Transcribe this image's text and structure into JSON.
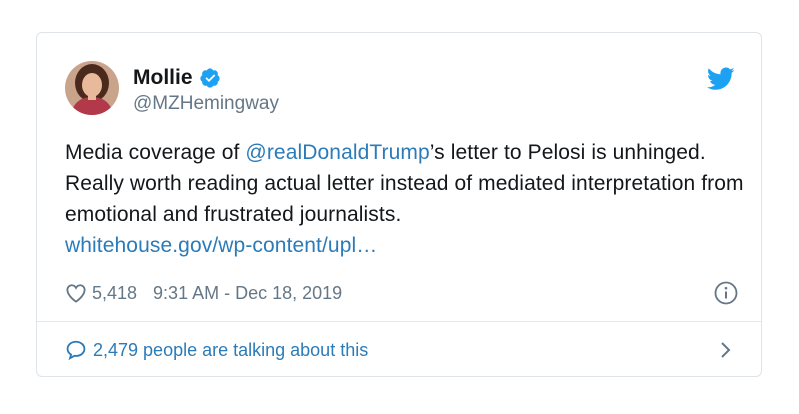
{
  "tweet": {
    "display_name": "Mollie",
    "handle": "@MZHemingway",
    "verified": true,
    "text_part1": "Media coverage of ",
    "mention": "@realDonaldTrump",
    "text_part2": "’s letter to Pelosi is unhinged. Really worth reading actual letter instead of mediated interpretation from emotional and frustrated journalists.",
    "link": "whitehouse.gov/wp-content/upl…",
    "like_count": "5,418",
    "timestamp": "9:31 AM - Dec 18, 2019",
    "conversation": "2,479 people are talking about this"
  },
  "icons": {
    "verified": "verified-badge-icon",
    "brand": "twitter-bird-icon",
    "like": "heart-icon",
    "info": "info-icon",
    "reply": "reply-bubble-icon",
    "chevron": "chevron-right-icon"
  },
  "colors": {
    "accent": "#2b7bb9",
    "verified": "#1da1f2",
    "text": "#14171a",
    "muted": "#657786",
    "border": "#dfe4e8"
  }
}
